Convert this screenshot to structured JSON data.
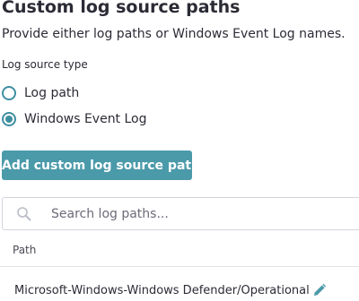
{
  "header": {
    "title": "Custom log source paths",
    "subtitle": "Provide either log paths or Windows Event Log names."
  },
  "log_source_type": {
    "label": "Log source type",
    "options": [
      {
        "label": "Log path",
        "selected": false
      },
      {
        "label": "Windows Event Log",
        "selected": true
      }
    ]
  },
  "actions": {
    "add_label": "Add custom log source path"
  },
  "search": {
    "placeholder": "Search log paths...",
    "value": ""
  },
  "table": {
    "columns": [
      "Path"
    ],
    "rows": [
      {
        "path": "Microsoft-Windows-Windows Defender/Operational"
      }
    ]
  },
  "colors": {
    "accent": "#4b9aaa",
    "radio": "#3f8fa2",
    "edit_icon": "#4b9aaa"
  },
  "icons": {
    "search": "search-icon",
    "edit": "pencil-icon"
  }
}
